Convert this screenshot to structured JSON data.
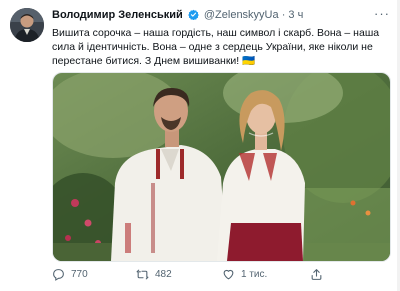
{
  "tweet": {
    "author_name": "Володимир Зеленський",
    "handle": "@ZelenskyyUa",
    "separator": "·",
    "time": "3 ч",
    "more_label": "···",
    "text": "Вишита сорочка – наша гордість, наш символ і скарб. Вона – наша сила й ідентичність. Вона – одне з сердець України, яке ніколи не перестане битися. З Днем вишиванки! 🇺🇦",
    "replies": "770",
    "retweets": "482",
    "likes": "1 тис."
  },
  "icons": {
    "verified": "verified-badge-icon",
    "reply": "reply-icon",
    "retweet": "retweet-icon",
    "like": "heart-icon",
    "share": "share-icon"
  },
  "colors": {
    "text": "#0f1419",
    "muted": "#536471",
    "verified": "#1d9bf0"
  }
}
